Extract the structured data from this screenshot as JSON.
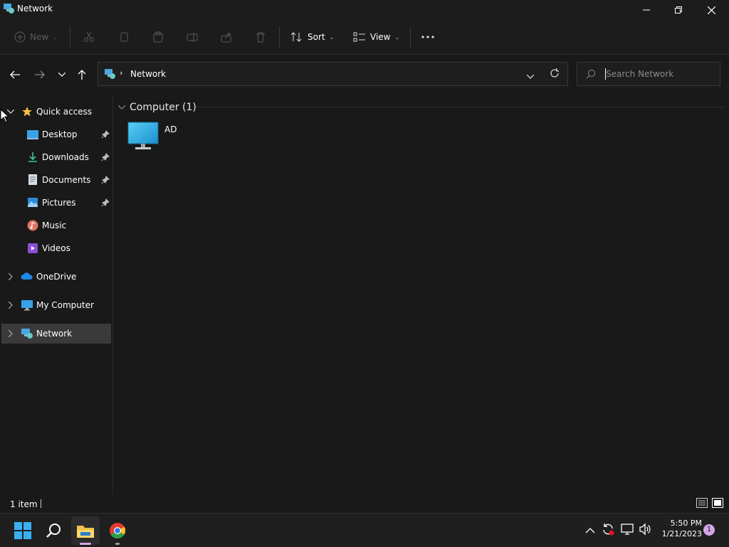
{
  "window": {
    "title": "Network"
  },
  "commandbar": {
    "new_label": "New",
    "sort_label": "Sort",
    "view_label": "View"
  },
  "address": {
    "crumb": "Network",
    "search_placeholder": "Search Network"
  },
  "nav": {
    "quick_access": "Quick access",
    "items": [
      {
        "label": "Desktop",
        "pinned": true,
        "icon": "desktop-icon"
      },
      {
        "label": "Downloads",
        "pinned": true,
        "icon": "downloads-icon"
      },
      {
        "label": "Documents",
        "pinned": true,
        "icon": "documents-icon"
      },
      {
        "label": "Pictures",
        "pinned": true,
        "icon": "pictures-icon"
      },
      {
        "label": "Music",
        "pinned": false,
        "icon": "music-icon"
      },
      {
        "label": "Videos",
        "pinned": false,
        "icon": "videos-icon"
      }
    ],
    "onedrive": "OneDrive",
    "my_computer": "My Computer",
    "network": "Network"
  },
  "content": {
    "group_header": "Computer (1)",
    "items": [
      {
        "name": "AD",
        "icon": "monitor-icon"
      }
    ]
  },
  "status": {
    "count": "1 item"
  },
  "taskbar": {
    "time": "5:50 PM",
    "date": "1/21/2023",
    "notification_count": "1"
  },
  "colors": {
    "selection": "#3a3a3a",
    "accent_blue": "#3aa0e8",
    "star": "#f6c343",
    "badge": "#d3a6e8"
  }
}
